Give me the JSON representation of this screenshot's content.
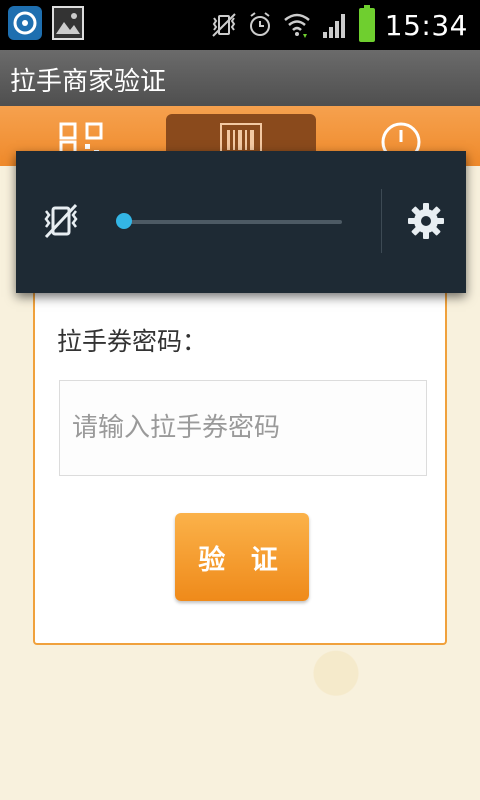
{
  "status_bar": {
    "time": "15:34",
    "icons": [
      "app-icon",
      "gallery-icon",
      "vibrate-icon",
      "alarm-icon",
      "wifi-icon",
      "signal-icon",
      "battery-icon"
    ]
  },
  "title_bar": {
    "title": "拉手商家验证"
  },
  "tabs": [
    {
      "icon": "qr-code-icon"
    },
    {
      "icon": "barcode-icon",
      "active": true
    },
    {
      "icon": "clock-icon"
    }
  ],
  "form": {
    "label": "拉手券密码：",
    "input_placeholder": "请输入拉手券密码",
    "input_value": "",
    "submit_label": "验 证"
  },
  "volume_panel": {
    "mute_icon": "vibrate-mute-icon",
    "level": 0.0,
    "settings_icon": "gear-icon"
  },
  "colors": {
    "accent_orange": "#ef8a2b",
    "panel_bg": "#1e2a34",
    "slider_blue": "#33b5e5"
  }
}
